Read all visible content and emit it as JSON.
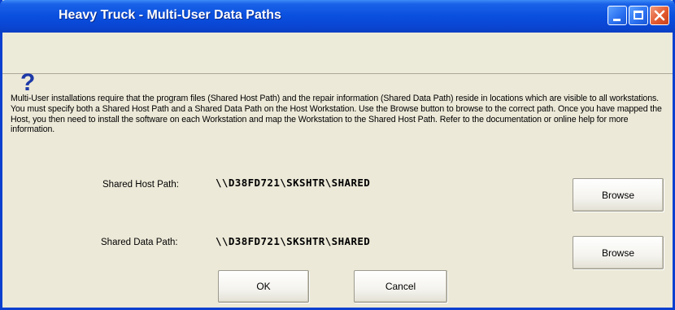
{
  "window": {
    "title": "Heavy Truck - Multi-User Data Paths",
    "controls": {
      "minimize": "minimize-icon",
      "maximize": "maximize-icon",
      "close": "close-icon"
    }
  },
  "header": {
    "icon_glyph": "?",
    "icon": "question-icon"
  },
  "description": "Multi-User installations require that the program files (Shared Host Path) and the repair information (Shared Data Path) reside in locations which are visible to all workstations.  You must specify both a Shared Host Path and a Shared Data Path on the Host Workstation.  Use the Browse button to browse to the correct path.  Once you have mapped the Host, you then need to install the software on each Workstation and map the Workstation to the Shared Host Path.  Refer to the documentation or online help for more information.",
  "fields": {
    "host": {
      "label": "Shared Host Path:",
      "value": "\\\\D38FD721\\SKSHTR\\SHARED",
      "browse_label": "Browse"
    },
    "data": {
      "label": "Shared Data Path:",
      "value": "\\\\D38FD721\\SKSHTR\\SHARED",
      "browse_label": "Browse"
    }
  },
  "buttons": {
    "ok": "OK",
    "cancel": "Cancel"
  },
  "colors": {
    "titlebar": "#0a4fde",
    "dialog_bg": "#ece9d8",
    "close_button": "#e35a30",
    "icon": "#1d39a8"
  }
}
